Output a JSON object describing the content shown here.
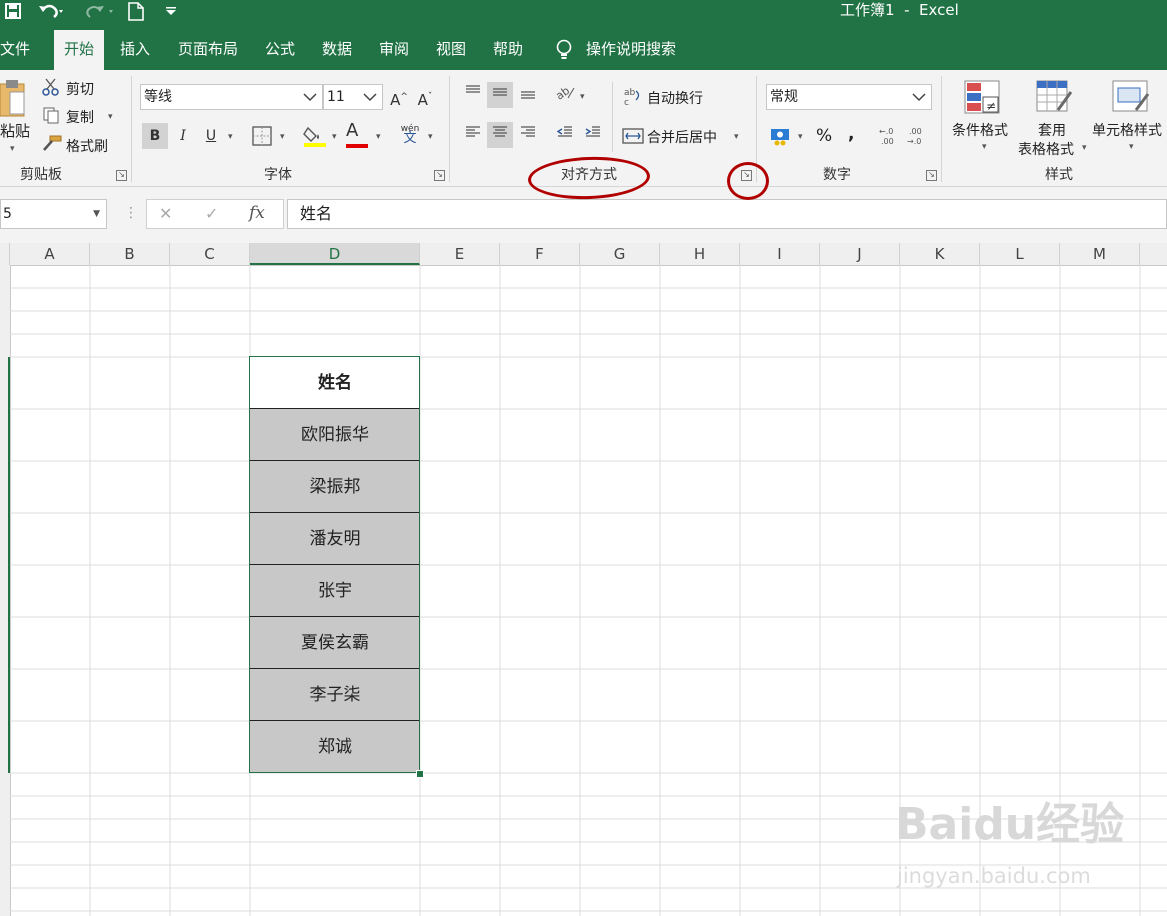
{
  "window": {
    "title": "工作簿1  -  Excel"
  },
  "quick_access": {
    "save_icon": "save-icon",
    "undo_icon": "undo-icon",
    "redo_icon": "redo-icon",
    "new_icon": "new-document-icon",
    "customize_icon": "customize-icon"
  },
  "tabs": [
    {
      "label": "文件"
    },
    {
      "label": "开始"
    },
    {
      "label": "插入"
    },
    {
      "label": "页面布局"
    },
    {
      "label": "公式"
    },
    {
      "label": "数据"
    },
    {
      "label": "审阅"
    },
    {
      "label": "视图"
    },
    {
      "label": "帮助"
    }
  ],
  "tell_me": {
    "label": "操作说明搜索"
  },
  "clipboard": {
    "paste": "粘贴",
    "cut": "剪切",
    "copy": "复制",
    "format_painter": "格式刷",
    "group": "剪贴板"
  },
  "font": {
    "name": "等线",
    "size": "11",
    "group": "字体",
    "bold": "B",
    "italic": "I",
    "underline": "U",
    "color_letter": "A",
    "phonetic": "wén",
    "font_color": "#e00000",
    "highlight_color": "#ffff00"
  },
  "alignment": {
    "wrap_text": "自动换行",
    "merge_center": "合并后居中",
    "group": "对齐方式"
  },
  "number": {
    "format": "常规",
    "group": "数字",
    "percent": "%",
    "comma": ",",
    "inc_decimal": "←.0\n.00",
    "dec_decimal": ".00\n→.0"
  },
  "styles": {
    "conditional": "条件格式",
    "table_1": "套用",
    "table_2": "表格格式",
    "cell_styles": "单元格样式",
    "group": "样式"
  },
  "formula_bar": {
    "name_box": "5",
    "cancel": "✕",
    "enter": "✓",
    "fx": "fx",
    "content": "姓名"
  },
  "columns": [
    "A",
    "B",
    "C",
    "D",
    "E",
    "F",
    "G",
    "H",
    "I",
    "J",
    "K",
    "L",
    "M"
  ],
  "cells": {
    "header": "姓名",
    "names": [
      "欧阳振华",
      "梁振邦",
      "潘友明",
      "张宇",
      "夏侯玄霸",
      "李子柒",
      "郑诚"
    ]
  },
  "watermark": {
    "brand": "Baidu经验",
    "url": "jingyan.baidu.com"
  },
  "colors": {
    "accent": "#217346",
    "annotation": "#b00000",
    "selected_fill": "#c8c8c8"
  }
}
